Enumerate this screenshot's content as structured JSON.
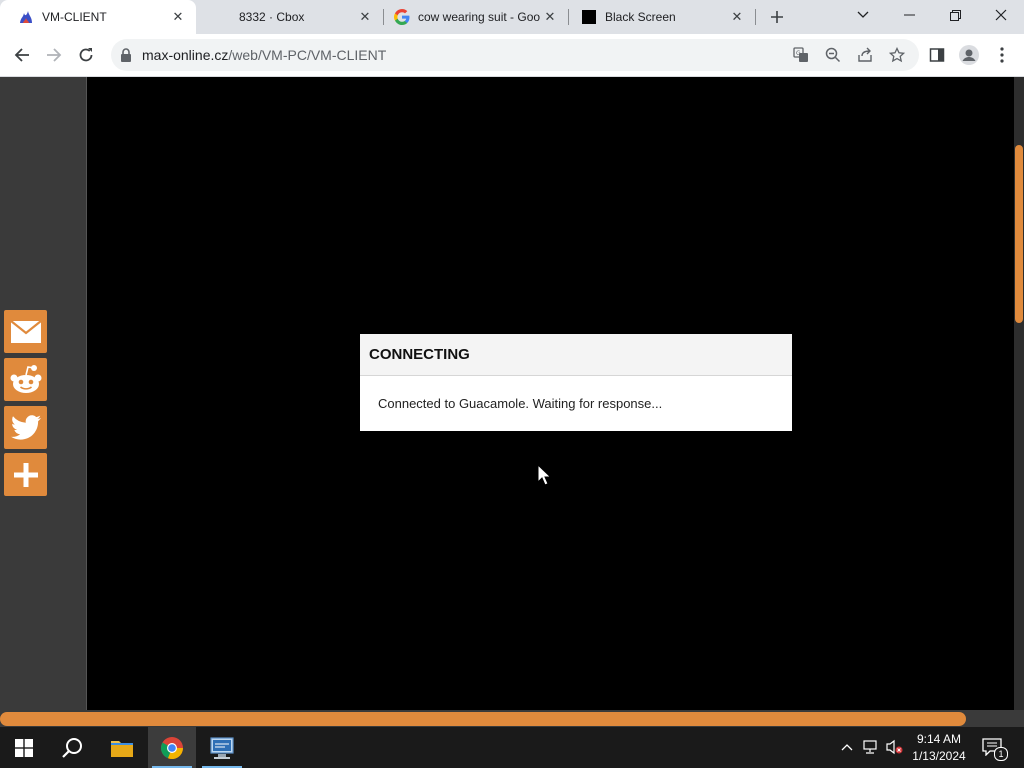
{
  "browser": {
    "tabs": [
      {
        "title": "VM-CLIENT",
        "favicon": "guacamole-icon",
        "active": true
      },
      {
        "title": "8332 · Cbox",
        "favicon": "none",
        "active": false
      },
      {
        "title": "cow wearing suit - Goo",
        "favicon": "google-icon",
        "active": false
      },
      {
        "title": "Black Screen",
        "favicon": "black-square-icon",
        "active": false
      }
    ],
    "url_host": "max-online.cz",
    "url_path": "/web/VM-PC/VM-CLIENT"
  },
  "dialog": {
    "title": "CONNECTING",
    "message": "Connected to Guacamole. Waiting for response..."
  },
  "share_buttons": [
    "email-icon",
    "reddit-icon",
    "twitter-icon",
    "plus-icon"
  ],
  "colors": {
    "accent": "#e08a3c",
    "vm_background": "#000000",
    "taskbar": "#1a1a1a"
  },
  "taskbar": {
    "time": "9:14 AM",
    "date": "1/13/2024",
    "notification_count": "1"
  }
}
